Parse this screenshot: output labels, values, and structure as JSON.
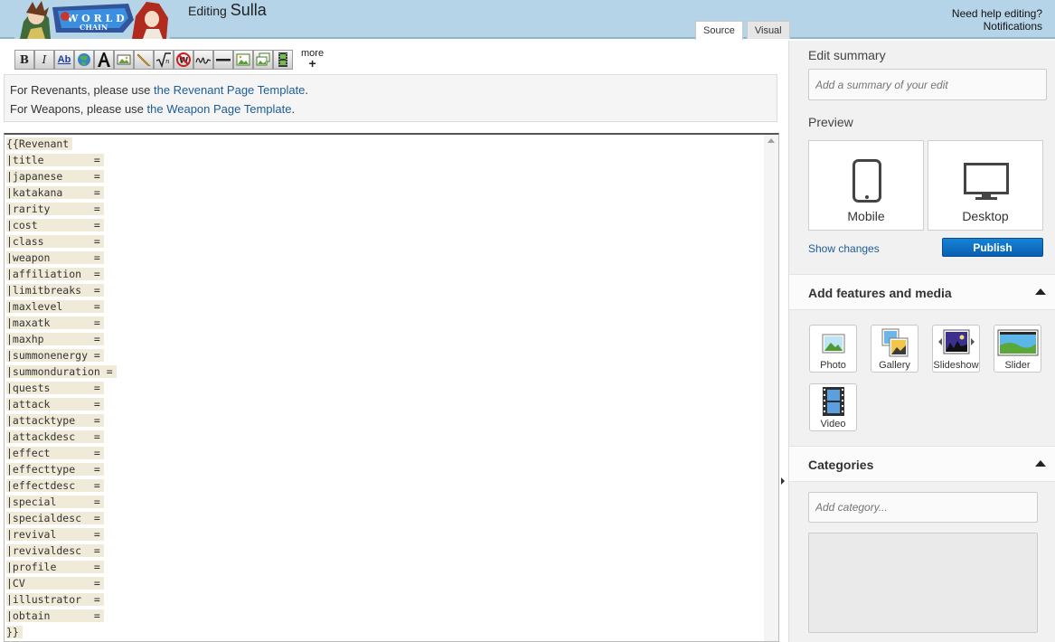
{
  "header": {
    "editing_label": "Editing",
    "page_name": "Sulla",
    "tabs": [
      {
        "label": "Source",
        "active": true
      },
      {
        "label": "Visual",
        "active": false
      }
    ],
    "help_link": "Need help editing?",
    "notifications_link": "Notifications"
  },
  "toolbar": {
    "bold_label": "B",
    "italic_label": "I",
    "link_label": "Ab",
    "more_label": "more",
    "more_plus": "+"
  },
  "notice": {
    "line1_prefix": "For Revenants, please use ",
    "line1_link": "the Revenant Page Template",
    "line1_suffix": ".",
    "line2_prefix": "For Weapons, please use ",
    "line2_link": "the Weapon Page Template",
    "line2_suffix": "."
  },
  "source_text": {
    "lines": [
      "{{Revenant",
      "|title        =",
      "|japanese     =",
      "|katakana     =",
      "|rarity       =",
      "|cost         =",
      "|class        =",
      "|weapon       =",
      "|affiliation  =",
      "|limitbreaks  =",
      "|maxlevel     =",
      "|maxatk       =",
      "|maxhp        =",
      "|summonenergy =",
      "|summonduration =",
      "|quests       =",
      "|attack       =",
      "|attacktype   =",
      "|attackdesc   =",
      "|effect       =",
      "|effecttype   =",
      "|effectdesc   =",
      "|special      =",
      "|specialdesc  =",
      "|revival      =",
      "|revivaldesc  =",
      "|profile      =",
      "|CV           =",
      "|illustrator  =",
      "|obtain       =",
      "}}"
    ]
  },
  "rail": {
    "edit_summary_label": "Edit summary",
    "summary_placeholder": "Add a summary of your edit",
    "preview_label": "Preview",
    "preview_mobile": "Mobile",
    "preview_desktop": "Desktop",
    "show_changes": "Show changes",
    "publish": "Publish",
    "features_title": "Add features and media",
    "media": {
      "photo": "Photo",
      "gallery": "Gallery",
      "slideshow": "Slideshow",
      "slider": "Slider",
      "video": "Video"
    },
    "categories_title": "Categories",
    "category_placeholder": "Add category..."
  },
  "colors": {
    "header_bg": "#b6d4e8",
    "link": "#1d5c96",
    "publish": "#0a6fc2"
  }
}
